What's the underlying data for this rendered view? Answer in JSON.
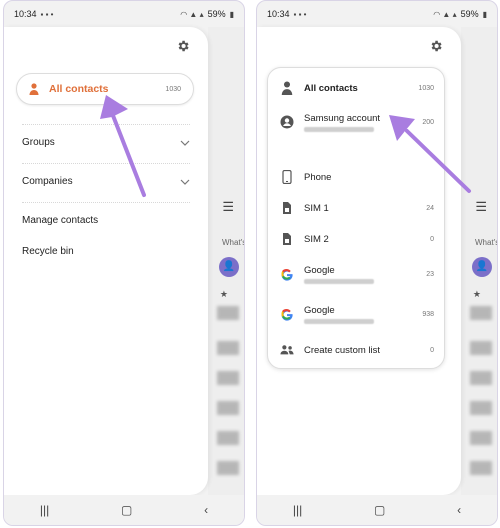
{
  "status_bar": {
    "time": "10:34",
    "battery": "59%"
  },
  "left": {
    "all_contacts": {
      "label": "All contacts",
      "count": "1030"
    },
    "menu": [
      {
        "label": "Groups"
      },
      {
        "label": "Companies"
      },
      {
        "label": "Manage contacts"
      },
      {
        "label": "Recycle bin"
      }
    ]
  },
  "background": {
    "whats_text": "What's"
  },
  "right": {
    "items": [
      {
        "label": "All contacts",
        "count": "1030",
        "icon": "person-icon"
      },
      {
        "label": "Samsung account",
        "count": "200",
        "icon": "account-circle-icon"
      },
      {
        "label": "Phone",
        "count": "",
        "icon": "phone-icon"
      },
      {
        "label": "SIM 1",
        "count": "24",
        "icon": "sim-icon"
      },
      {
        "label": "SIM 2",
        "count": "0",
        "icon": "sim-icon"
      },
      {
        "label": "Google",
        "count": "23",
        "icon": "google-icon"
      },
      {
        "label": "Google",
        "count": "938",
        "icon": "google-icon"
      },
      {
        "label": "Create custom list",
        "count": "0",
        "icon": "group-icon"
      }
    ]
  },
  "colors": {
    "accent_orange": "#e0703a",
    "arrow_purple": "#a97de0"
  }
}
